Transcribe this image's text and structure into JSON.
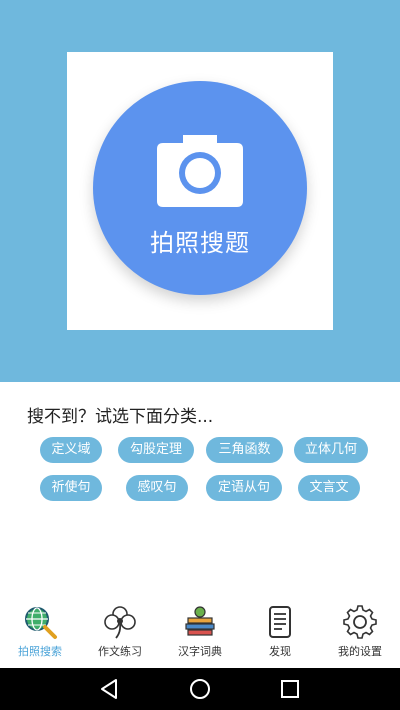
{
  "hero": {
    "button_label": "拍照搜题",
    "background_color": "#6fb8dd",
    "circle_color": "#5c93ee"
  },
  "prompt_text": "搜不到？试选下面分类...",
  "categories": [
    "定义域",
    "勾股定理",
    "三角函数",
    "立体几何",
    "祈使句",
    "感叹句",
    "定语从句",
    "文言文"
  ],
  "tabs": [
    {
      "label": "拍照搜索",
      "icon": "globe-search-icon",
      "active": true
    },
    {
      "label": "作文练习",
      "icon": "clover-icon",
      "active": false
    },
    {
      "label": "汉字词典",
      "icon": "books-icon",
      "active": false
    },
    {
      "label": "发现",
      "icon": "document-icon",
      "active": false
    },
    {
      "label": "我的设置",
      "icon": "gear-icon",
      "active": false
    }
  ],
  "system_nav": {
    "icons": [
      "back-icon",
      "home-icon",
      "recents-icon"
    ]
  }
}
